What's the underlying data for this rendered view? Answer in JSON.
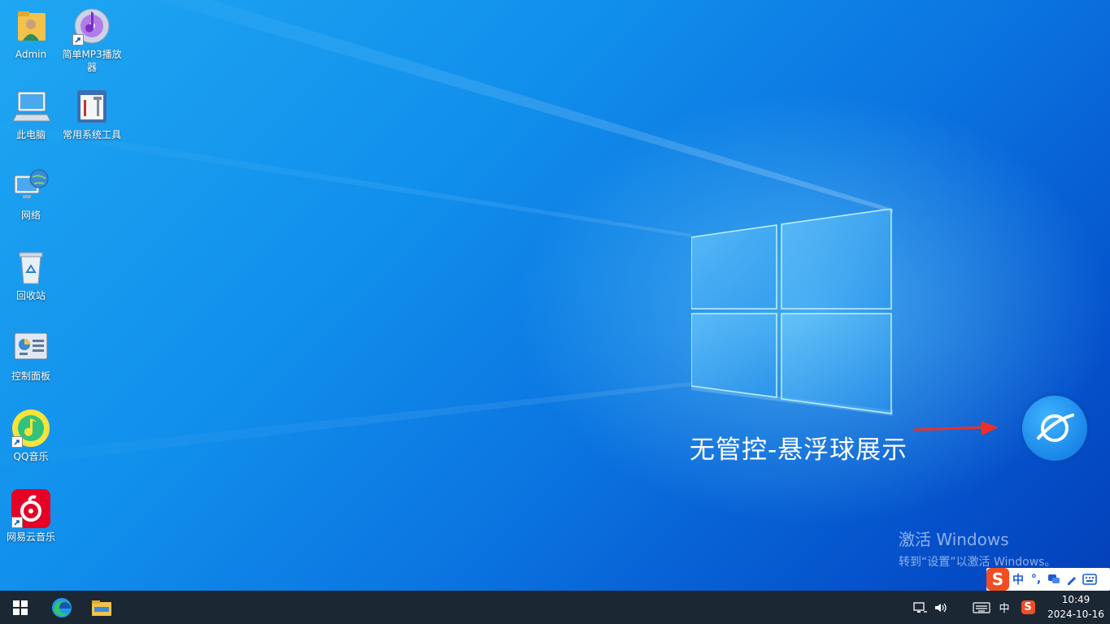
{
  "desktop": {
    "icons": [
      {
        "label": "Admin",
        "icon": "user-folder-icon"
      },
      {
        "label": "简单MP3播放器",
        "icon": "mp3-player-icon"
      },
      {
        "label": "此电脑",
        "icon": "computer-icon"
      },
      {
        "label": "常用系统工具",
        "icon": "tools-icon"
      },
      {
        "label": "网络",
        "icon": "network-icon"
      },
      {
        "label": "回收站",
        "icon": "recycle-bin-icon"
      },
      {
        "label": "控制面板",
        "icon": "control-panel-icon"
      },
      {
        "label": "QQ音乐",
        "icon": "qq-music-icon"
      },
      {
        "label": "网易云音乐",
        "icon": "netease-music-icon"
      }
    ],
    "caption": "无管控-悬浮球展示",
    "watermark": {
      "line1": "激活 Windows",
      "line2": "转到“设置”以激活 Windows。"
    }
  },
  "ime_toolbar": {
    "logo": "S",
    "mode": "中",
    "punct": "°,",
    "items": [
      "chat-icon",
      "pen-icon",
      "keyboard-icon"
    ]
  },
  "taskbar": {
    "apps": [
      "start-icon",
      "edge-icon",
      "file-explorer-icon"
    ],
    "tray_lang": "中",
    "clock_time": "10:49",
    "clock_date": "2024-10-16"
  },
  "colors": {
    "accent": "#0b74e0",
    "taskbar": "#1c2734",
    "sogou": "#f04d23",
    "arrow": "#e8312c"
  }
}
